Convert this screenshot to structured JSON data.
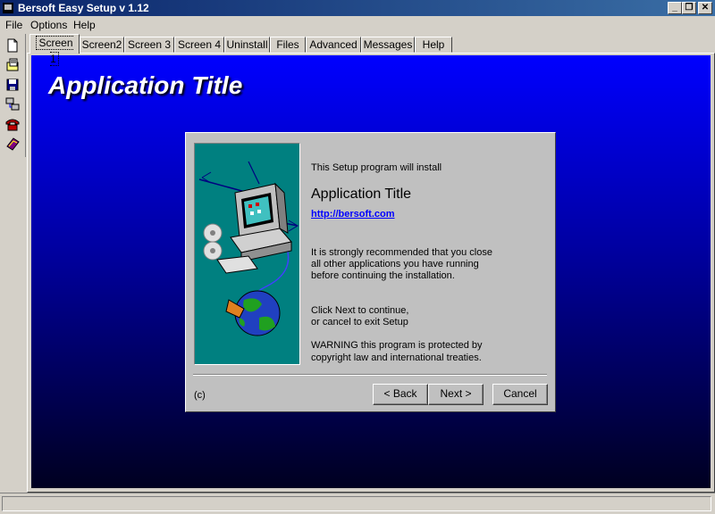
{
  "window": {
    "title": "Bersoft Easy Setup v 1.12",
    "controls": [
      "minimize-icon",
      "restore-icon",
      "close-icon"
    ]
  },
  "menu": {
    "items": [
      "File",
      "Options",
      "Help"
    ]
  },
  "toolbar": {
    "icons": [
      "new-file-icon",
      "open-file-icon",
      "save-icon",
      "network-icon",
      "phone-icon",
      "book-icon"
    ]
  },
  "tabs": {
    "active": "Screen 1",
    "items": [
      "Screen 1",
      "Screen2",
      "Screen 3",
      "Screen 4",
      "Uninstall",
      "Files",
      "Advanced",
      "Messages",
      "Help"
    ]
  },
  "main": {
    "app_title": "Application Title",
    "background_colors": [
      "#0000ff",
      "#000020"
    ]
  },
  "dialog": {
    "intro": "This Setup program will install",
    "heading": "Application Title",
    "link": "http://bersoft.com",
    "recommend": [
      "It is strongly recommended that you close",
      "all other applications you have running",
      "before continuing the installation."
    ],
    "continue": [
      "Click Next to continue,",
      "or cancel to exit Setup"
    ],
    "warning": [
      "WARNING this program is protected by",
      "copyright law and international treaties."
    ],
    "copyright": "(c)",
    "buttons": {
      "back": "< Back",
      "next": "Next >",
      "cancel": "Cancel"
    },
    "art_color": "#008080"
  }
}
